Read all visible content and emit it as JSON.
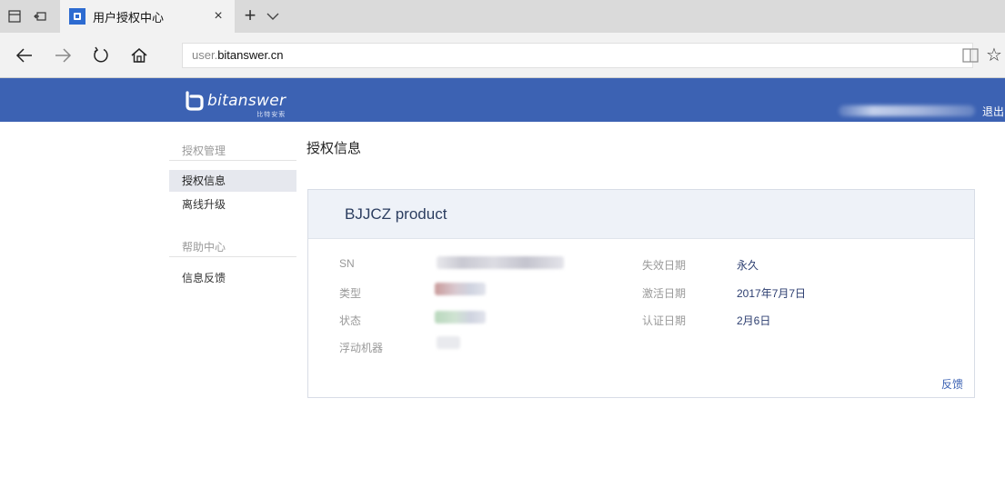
{
  "browser": {
    "tab_title": "用户授权中心",
    "tab_close": "×",
    "tab_new": "+",
    "url_subdomain": "user.",
    "url_domain": "bitanswer.cn",
    "favorites_glyph": "☆"
  },
  "header": {
    "logo_text": "bitanswer",
    "logo_subtext": "比特安索",
    "logout": "退出",
    "brand_color": "#3c62b3"
  },
  "sidebar": {
    "groups": [
      {
        "label": "授权管理",
        "items": [
          {
            "label": "授权信息",
            "active": true
          },
          {
            "label": "离线升级",
            "active": false
          }
        ]
      },
      {
        "label": "帮助中心",
        "items": [
          {
            "label": "信息反馈",
            "active": false
          }
        ]
      }
    ]
  },
  "main": {
    "page_title": "授权信息",
    "card": {
      "product_name": "BJJCZ product",
      "left_fields": [
        {
          "label": "SN"
        },
        {
          "label": "类型"
        },
        {
          "label": "状态"
        },
        {
          "label": "浮动机器"
        }
      ],
      "right_fields": [
        {
          "label": "失效日期",
          "value": "永久"
        },
        {
          "label": "激活日期",
          "value": "2017年7月7日"
        },
        {
          "label": "认证日期",
          "value": "2月6日"
        }
      ],
      "feedback_link": "反馈"
    }
  }
}
